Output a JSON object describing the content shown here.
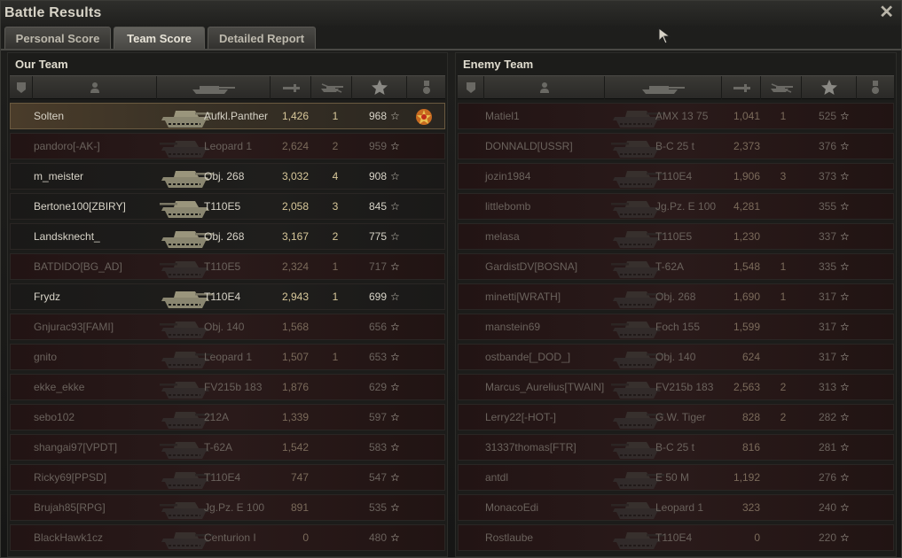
{
  "window": {
    "title": "Battle Results",
    "close_icon": "close-icon"
  },
  "tabs": [
    {
      "label": "Personal Score",
      "active": false
    },
    {
      "label": "Team Score",
      "active": true
    },
    {
      "label": "Detailed Report",
      "active": false
    }
  ],
  "colors": {
    "self_row": "#4a3c2a",
    "dead_text": "#6a625c",
    "kills_dmg": "#d8c89a",
    "star": "#c8c4b8"
  },
  "columns": [
    "platoon-icon",
    "player-icon",
    "vehicle-icon",
    "damage-icon",
    "kills-icon",
    "xp-star-icon",
    "medal-icon"
  ],
  "our_team": {
    "title": "Our Team",
    "rows": [
      {
        "name": "Solten",
        "vehicle": "Aufkl.Panther",
        "damage": "1,426",
        "kills": "1",
        "xp": "968",
        "state": "self",
        "medal": true
      },
      {
        "name": "pandoro[-AK-]",
        "vehicle": "Leopard 1",
        "damage": "2,624",
        "kills": "2",
        "xp": "959",
        "state": "dead"
      },
      {
        "name": "m_meister",
        "vehicle": "Obj. 268",
        "damage": "3,032",
        "kills": "4",
        "xp": "908",
        "state": "alive"
      },
      {
        "name": "Bertone100[ZBIRY]",
        "vehicle": "T110E5",
        "damage": "2,058",
        "kills": "3",
        "xp": "845",
        "state": "alive"
      },
      {
        "name": "Landsknecht_",
        "vehicle": "Obj. 268",
        "damage": "3,167",
        "kills": "2",
        "xp": "775",
        "state": "alive"
      },
      {
        "name": "BATDIDO[BG_AD]",
        "vehicle": "T110E5",
        "damage": "2,324",
        "kills": "1",
        "xp": "717",
        "state": "dead"
      },
      {
        "name": "Frydz",
        "vehicle": "T110E4",
        "damage": "2,943",
        "kills": "1",
        "xp": "699",
        "state": "alive"
      },
      {
        "name": "Gnjurac93[FAMI]",
        "vehicle": "Obj. 140",
        "damage": "1,568",
        "kills": "",
        "xp": "656",
        "state": "dead"
      },
      {
        "name": "gnito",
        "vehicle": "Leopard 1",
        "damage": "1,507",
        "kills": "1",
        "xp": "653",
        "state": "dead"
      },
      {
        "name": "ekke_ekke",
        "vehicle": "FV215b 183",
        "damage": "1,876",
        "kills": "",
        "xp": "629",
        "state": "dead"
      },
      {
        "name": "sebo102",
        "vehicle": "212A",
        "damage": "1,339",
        "kills": "",
        "xp": "597",
        "state": "dead"
      },
      {
        "name": "shangai97[VPDT]",
        "vehicle": "T-62A",
        "damage": "1,542",
        "kills": "",
        "xp": "583",
        "state": "dead"
      },
      {
        "name": "Ricky69[PPSD]",
        "vehicle": "T110E4",
        "damage": "747",
        "kills": "",
        "xp": "547",
        "state": "dead"
      },
      {
        "name": "Brujah85[RPG]",
        "vehicle": "Jg.Pz. E 100",
        "damage": "891",
        "kills": "",
        "xp": "535",
        "state": "dead"
      },
      {
        "name": "BlackHawk1cz",
        "vehicle": "Centurion I",
        "damage": "0",
        "kills": "",
        "xp": "480",
        "state": "dead"
      }
    ]
  },
  "enemy_team": {
    "title": "Enemy Team",
    "rows": [
      {
        "name": "Matiel1",
        "vehicle": "AMX 13 75",
        "damage": "1,041",
        "kills": "1",
        "xp": "525",
        "state": "dead"
      },
      {
        "name": "DONNALD[USSR]",
        "vehicle": "B-C 25 t",
        "damage": "2,373",
        "kills": "",
        "xp": "376",
        "state": "dead"
      },
      {
        "name": "jozin1984",
        "vehicle": "T110E4",
        "damage": "1,906",
        "kills": "3",
        "xp": "373",
        "state": "dead"
      },
      {
        "name": "littlebomb",
        "vehicle": "Jg.Pz. E 100",
        "damage": "4,281",
        "kills": "",
        "xp": "355",
        "state": "dead"
      },
      {
        "name": "melasa",
        "vehicle": "T110E5",
        "damage": "1,230",
        "kills": "",
        "xp": "337",
        "state": "dead"
      },
      {
        "name": "GardistDV[BOSNA]",
        "vehicle": "T-62A",
        "damage": "1,548",
        "kills": "1",
        "xp": "335",
        "state": "dead"
      },
      {
        "name": "minetti[WRATH]",
        "vehicle": "Obj. 268",
        "damage": "1,690",
        "kills": "1",
        "xp": "317",
        "state": "dead"
      },
      {
        "name": "manstein69",
        "vehicle": "Foch 155",
        "damage": "1,599",
        "kills": "",
        "xp": "317",
        "state": "dead"
      },
      {
        "name": "ostbande[_DOD_]",
        "vehicle": "Obj. 140",
        "damage": "624",
        "kills": "",
        "xp": "317",
        "state": "dead"
      },
      {
        "name": "Marcus_Aurelius[TWAIN]",
        "vehicle": "FV215b 183",
        "damage": "2,563",
        "kills": "2",
        "xp": "313",
        "state": "dead"
      },
      {
        "name": "Lerry22[-HOT-]",
        "vehicle": "G.W. Tiger",
        "damage": "828",
        "kills": "2",
        "xp": "282",
        "state": "dead"
      },
      {
        "name": "31337thomas[FTR]",
        "vehicle": "B-C 25 t",
        "damage": "816",
        "kills": "",
        "xp": "281",
        "state": "dead"
      },
      {
        "name": "antdl",
        "vehicle": "E 50 M",
        "damage": "1,192",
        "kills": "",
        "xp": "276",
        "state": "dead"
      },
      {
        "name": "MonacoEdi",
        "vehicle": "Leopard 1",
        "damage": "323",
        "kills": "",
        "xp": "240",
        "state": "dead"
      },
      {
        "name": "Rostlaube",
        "vehicle": "T110E4",
        "damage": "0",
        "kills": "",
        "xp": "220",
        "state": "dead"
      }
    ]
  }
}
